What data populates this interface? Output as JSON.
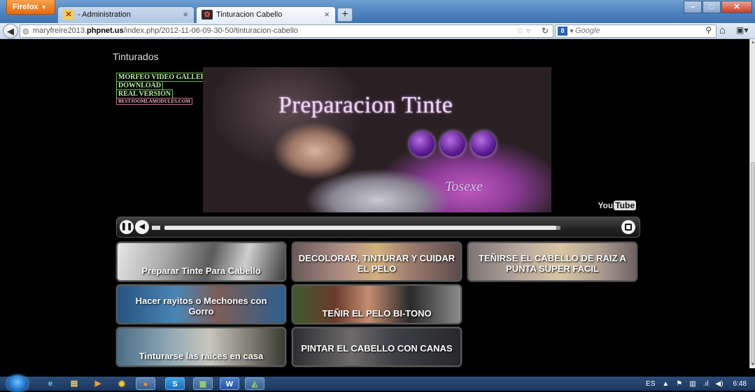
{
  "browser": {
    "app_button": "Firefox",
    "tabs": [
      {
        "label": "- Administration",
        "active": false
      },
      {
        "label": "Tinturacion Cabello",
        "active": true
      }
    ],
    "new_tab": "+",
    "url": {
      "prefix": "maryfreire2013.",
      "domain": "phpnet.us",
      "path": "/index.php/2012-11-06-09-30-50/tinturacion-cabello"
    },
    "search_placeholder": "Google"
  },
  "page": {
    "section_title": "Tinturados",
    "video": {
      "title_text": "Preparacion Tinte",
      "signature": "Tosexe",
      "watermark": [
        "MORFEO VIDEO GALLERY",
        "DOWNLOAD",
        "REAL VERSION",
        "BESTJOOMLAMODULES.COM"
      ],
      "youtube_you": "You",
      "youtube_tube": "Tube"
    },
    "progress": 0.99,
    "playlist": [
      {
        "caption": "Preparar Tinte Para Cabello"
      },
      {
        "caption": "DECOLORAR, TINTURAR Y CUIDAR EL PELO"
      },
      {
        "caption": "TEÑIRSE EL CABELLO DE RAIZ A PUNTA SUPER FACIL"
      },
      {
        "caption": "Hacer rayitos o Mechones con Gorro"
      },
      {
        "caption": "TEÑIR EL PELO BI-TONO"
      },
      {
        "caption": "Tinturarse las raices en casa"
      },
      {
        "caption": "PINTAR EL CABELLO CON CANAS"
      }
    ]
  },
  "taskbar": {
    "language": "ES",
    "time": "6:48"
  },
  "colors": {
    "page_background": "#000000",
    "firefox_orange": "#e66a12",
    "title_bar_blue": "#4d82bf"
  }
}
